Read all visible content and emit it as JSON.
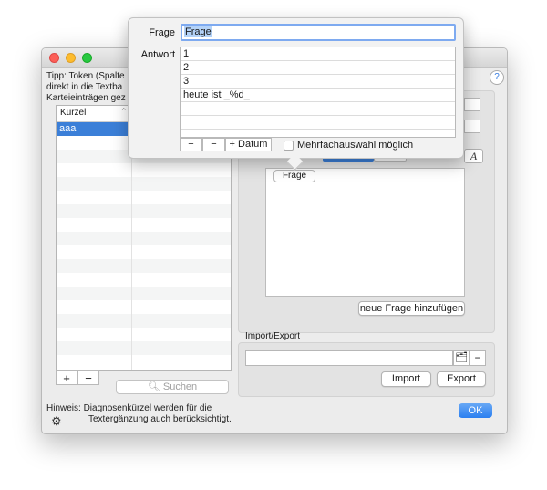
{
  "window": {
    "tip_lines": [
      "Tipp: Token (Spalte",
      "direkt in die Textba",
      "Karteieinträgen gez"
    ],
    "help_label": "?"
  },
  "table": {
    "column_header": "Kürzel",
    "rows": [
      "aaa"
    ],
    "add_label": "+",
    "remove_label": "−"
  },
  "search": {
    "placeholder": "Suchen",
    "icon": "magnifier-icon"
  },
  "question_editor": {
    "font_icon_label": "A",
    "question_pill": "Frage",
    "add_question_button": "neue Frage hinzufügen"
  },
  "import_export": {
    "label": "Import/Export",
    "path_value": "",
    "import_button": "Import",
    "export_button": "Export",
    "remove_label": "−"
  },
  "footer": {
    "hint_line1": "Hinweis: Diagnosenkürzel werden für die",
    "hint_line2": "Textergänzung auch berücksichtigt.",
    "ok_button": "OK"
  },
  "popover": {
    "frage_label": "Frage",
    "frage_value": "Frage",
    "antwort_label": "Antwort",
    "answers": [
      "1",
      "2",
      "3",
      "heute ist _%d_"
    ],
    "add_label": "+",
    "remove_label": "−",
    "datum_button": "+ Datum",
    "multi_choice_label": "Mehrfachauswahl möglich",
    "multi_choice_checked": false
  },
  "colors": {
    "accent": "#3b7fd8",
    "ok_button": "#2b7ff0"
  }
}
